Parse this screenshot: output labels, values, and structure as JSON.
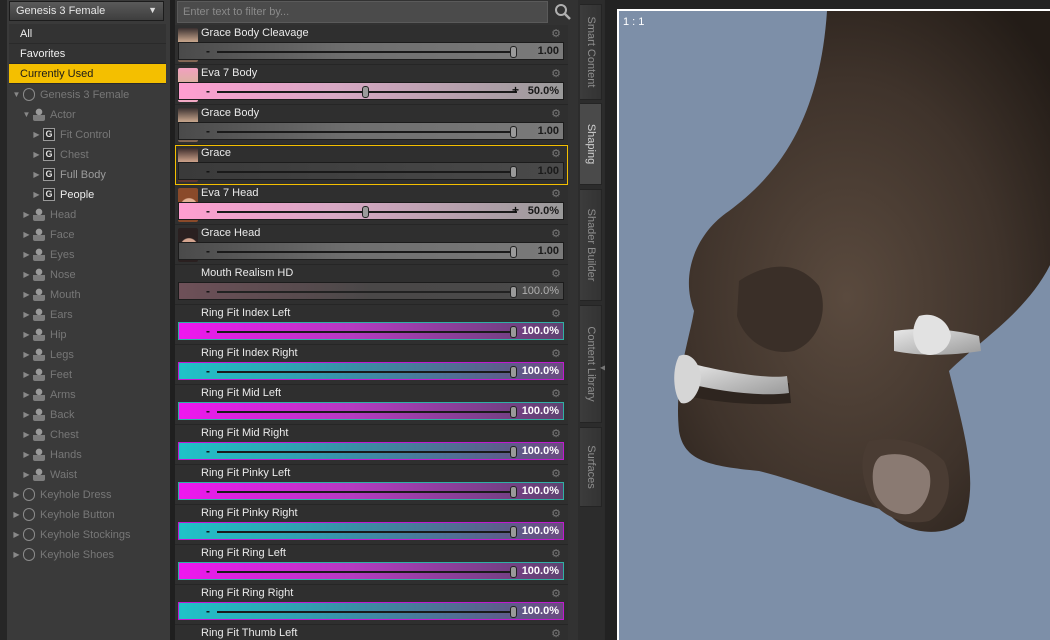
{
  "figure_select": {
    "value": "Genesis 3 Female"
  },
  "categories": [
    {
      "label": "All",
      "selected": false
    },
    {
      "label": "Favorites",
      "selected": false
    },
    {
      "label": "Currently Used",
      "selected": true
    }
  ],
  "tree": [
    {
      "label": "Genesis 3 Female",
      "level": 0,
      "icon": "figure-icon",
      "expanded": true,
      "style": "dim"
    },
    {
      "label": "Actor",
      "level": 1,
      "icon": "person-icon",
      "expanded": true,
      "style": "dim"
    },
    {
      "label": "Fit Control",
      "level": 2,
      "icon": "group-icon",
      "expanded": false,
      "style": "dim"
    },
    {
      "label": "Chest",
      "level": 2,
      "icon": "group-icon",
      "expanded": false,
      "style": "dim"
    },
    {
      "label": "Full Body",
      "level": 2,
      "icon": "group-icon",
      "expanded": false,
      "style": "mid"
    },
    {
      "label": "People",
      "level": 2,
      "icon": "group-icon",
      "expanded": false,
      "style": "bright"
    },
    {
      "label": "Head",
      "level": 1,
      "icon": "person-icon",
      "expanded": false,
      "style": "dim"
    },
    {
      "label": "Face",
      "level": 1,
      "icon": "person-icon",
      "expanded": false,
      "style": "dim"
    },
    {
      "label": "Eyes",
      "level": 1,
      "icon": "person-icon",
      "expanded": false,
      "style": "dim"
    },
    {
      "label": "Nose",
      "level": 1,
      "icon": "person-icon",
      "expanded": false,
      "style": "dim"
    },
    {
      "label": "Mouth",
      "level": 1,
      "icon": "person-icon",
      "expanded": false,
      "style": "dim"
    },
    {
      "label": "Ears",
      "level": 1,
      "icon": "person-icon",
      "expanded": false,
      "style": "dim"
    },
    {
      "label": "Hip",
      "level": 1,
      "icon": "person-icon",
      "expanded": false,
      "style": "dim"
    },
    {
      "label": "Legs",
      "level": 1,
      "icon": "person-icon",
      "expanded": false,
      "style": "dim"
    },
    {
      "label": "Feet",
      "level": 1,
      "icon": "person-icon",
      "expanded": false,
      "style": "dim"
    },
    {
      "label": "Arms",
      "level": 1,
      "icon": "person-icon",
      "expanded": false,
      "style": "dim"
    },
    {
      "label": "Back",
      "level": 1,
      "icon": "person-icon",
      "expanded": false,
      "style": "dim"
    },
    {
      "label": "Chest",
      "level": 1,
      "icon": "person-icon",
      "expanded": false,
      "style": "dim"
    },
    {
      "label": "Hands",
      "level": 1,
      "icon": "person-icon",
      "expanded": false,
      "style": "dim"
    },
    {
      "label": "Waist",
      "level": 1,
      "icon": "person-icon",
      "expanded": false,
      "style": "dim"
    },
    {
      "label": "Keyhole Dress",
      "level": 0,
      "icon": "figure-icon",
      "expanded": false,
      "style": "dim"
    },
    {
      "label": "Keyhole Button",
      "level": 0,
      "icon": "figure-icon",
      "expanded": false,
      "style": "dim"
    },
    {
      "label": "Keyhole Stockings",
      "level": 0,
      "icon": "figure-icon",
      "expanded": false,
      "style": "dim"
    },
    {
      "label": "Keyhole Shoes",
      "level": 0,
      "icon": "figure-icon",
      "expanded": false,
      "style": "dim"
    }
  ],
  "filter": {
    "placeholder": "Enter text to filter by..."
  },
  "sliders": [
    {
      "name": "Grace Body Cleavage",
      "value": "1.00",
      "level": 1.0,
      "track": "gray",
      "thumb": "bikini",
      "selected": false,
      "plus": false
    },
    {
      "name": "Eva 7 Body",
      "value": "50.0%",
      "level": 0.5,
      "track": "pink",
      "thumb": "pink",
      "selected": false,
      "plus": true
    },
    {
      "name": "Grace Body",
      "value": "1.00",
      "level": 1.0,
      "track": "gray",
      "thumb": "bikini",
      "selected": false,
      "plus": false
    },
    {
      "name": "Grace",
      "value": "1.00",
      "level": 1.0,
      "track": "dark",
      "thumb": "red",
      "selected": true,
      "plus": false
    },
    {
      "name": "Eva 7 Head",
      "value": "50.0%",
      "level": 0.5,
      "track": "pink",
      "thumb": "face",
      "selected": false,
      "plus": true
    },
    {
      "name": "Grace Head",
      "value": "1.00",
      "level": 1.0,
      "track": "gray",
      "thumb": "dark",
      "selected": false,
      "plus": false
    },
    {
      "name": "Mouth Realism HD",
      "value": "100.0%",
      "level": 1.0,
      "track": "mauve",
      "thumb": "",
      "selected": false,
      "plus": false
    },
    {
      "name": "Ring Fit Index Left",
      "value": "100.0%",
      "level": 1.0,
      "track": "magenta",
      "thumb": "",
      "selected": false,
      "plus": false
    },
    {
      "name": "Ring Fit Index Right",
      "value": "100.0%",
      "level": 1.0,
      "track": "cyan",
      "thumb": "",
      "selected": false,
      "plus": false
    },
    {
      "name": "Ring Fit Mid Left",
      "value": "100.0%",
      "level": 1.0,
      "track": "magenta",
      "thumb": "",
      "selected": false,
      "plus": false
    },
    {
      "name": "Ring Fit Mid Right",
      "value": "100.0%",
      "level": 1.0,
      "track": "cyan",
      "thumb": "",
      "selected": false,
      "plus": false
    },
    {
      "name": "Ring Fit Pinky Left",
      "value": "100.0%",
      "level": 1.0,
      "track": "magenta",
      "thumb": "",
      "selected": false,
      "plus": false
    },
    {
      "name": "Ring Fit Pinky Right",
      "value": "100.0%",
      "level": 1.0,
      "track": "cyan",
      "thumb": "",
      "selected": false,
      "plus": false
    },
    {
      "name": "Ring Fit Ring Left",
      "value": "100.0%",
      "level": 1.0,
      "track": "magenta",
      "thumb": "",
      "selected": false,
      "plus": false
    },
    {
      "name": "Ring Fit Ring Right",
      "value": "100.0%",
      "level": 1.0,
      "track": "cyan",
      "thumb": "",
      "selected": false,
      "plus": false
    },
    {
      "name": "Ring Fit Thumb Left",
      "value": "",
      "level": 1.0,
      "track": "magenta",
      "thumb": "",
      "selected": false,
      "plus": false
    }
  ],
  "tabs": [
    {
      "label": "Smart Content",
      "active": false
    },
    {
      "label": "Shaping",
      "active": true
    },
    {
      "label": "Shader Builder",
      "active": false
    },
    {
      "label": "Content Library",
      "active": false
    },
    {
      "label": "Surfaces",
      "active": false
    }
  ],
  "viewport": {
    "zoom": "1 : 1"
  },
  "colors": {
    "selection": "#f4bf00",
    "viewport_bg": "#7d8fa8",
    "skin": "#4a3c33"
  }
}
